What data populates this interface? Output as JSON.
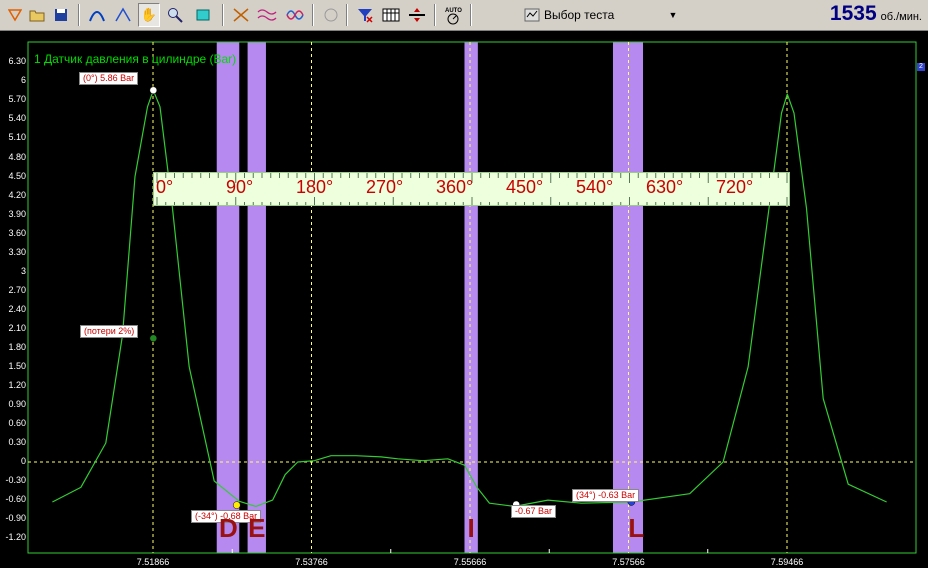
{
  "toolbar": {
    "test_select_label": "Выбор теста",
    "rpm_value": "1535",
    "rpm_unit": "об./мин."
  },
  "plot": {
    "title": "1 Датчик давления в цилиндре (Bar)",
    "y_ticks": [
      "6.30",
      "6",
      "5.70",
      "5.40",
      "5.10",
      "4.80",
      "4.50",
      "4.20",
      "3.90",
      "3.60",
      "3.30",
      "3",
      "2.70",
      "2.40",
      "2.10",
      "1.80",
      "1.50",
      "1.20",
      "0.90",
      "0.60",
      "0.30",
      "0",
      "-0.30",
      "-0.60",
      "-0.90",
      "-1.20"
    ],
    "x_ticks": [
      "7.51866",
      "7.53766",
      "7.55666",
      "7.57566",
      "7.59466"
    ],
    "ruler_ticks": [
      "0°",
      "90°",
      "180°",
      "270°",
      "360°",
      "450°",
      "540°",
      "630°",
      "720°"
    ],
    "markers": [
      "D",
      "E",
      "I",
      "L"
    ],
    "labels": {
      "peak": "(0°) 5.86 Bar",
      "loss": "(потери 2%)",
      "minus34": "(-34°) -0.68 Bar",
      "i_value": "-0.67 Bar",
      "plus34": "(34°) -0.63 Bar"
    },
    "corner": "2"
  },
  "colors": {
    "trace": "#33cc33",
    "title": "#00dd00",
    "highlight": "#b589f0",
    "grid": "#ffff66",
    "label_text": "#cc0000"
  },
  "chart_data": {
    "type": "line",
    "title": "1 Датчик давления в цилиндре (Bar)",
    "xlabel": "",
    "ylabel": "",
    "ylim": [
      -1.35,
      6.5
    ],
    "xlim": [
      7.5066,
      7.6066
    ],
    "x_ticks": [
      7.51866,
      7.53766,
      7.55666,
      7.57566,
      7.59466
    ],
    "series": [
      {
        "x": [
          7.5066,
          7.51,
          7.513,
          7.515,
          7.5165,
          7.518,
          7.5187,
          7.5195,
          7.521,
          7.523,
          7.526,
          7.529,
          7.531,
          7.533,
          7.5345,
          7.536,
          7.538,
          7.54,
          7.543,
          7.546,
          7.548,
          7.551,
          7.554,
          7.556,
          7.5575,
          7.559,
          7.562,
          7.566,
          7.57,
          7.576,
          7.583,
          7.587,
          7.59,
          7.5925,
          7.594,
          7.5947,
          7.5955,
          7.597,
          7.599,
          7.602,
          7.6066
        ],
        "y": [
          -0.63,
          -0.4,
          0.3,
          2.0,
          4.5,
          5.6,
          5.86,
          5.6,
          4.0,
          1.5,
          -0.3,
          -0.62,
          -0.7,
          -0.6,
          -0.2,
          0.0,
          0.02,
          0.1,
          0.1,
          0.08,
          0.05,
          0.02,
          0.05,
          -0.05,
          -0.4,
          -0.65,
          -0.7,
          -0.6,
          -0.65,
          -0.63,
          -0.5,
          0.0,
          1.5,
          4.0,
          5.5,
          5.8,
          5.5,
          4.0,
          1.0,
          -0.35,
          -0.63
        ]
      }
    ],
    "points": [
      {
        "x": 7.5187,
        "y": 5.86,
        "label": "(0°) 5.86 Bar"
      },
      {
        "x": 7.5187,
        "y": 1.95,
        "label": "(потери 2%)"
      },
      {
        "x": 7.5287,
        "y": -0.68,
        "label": "(-34°) -0.68 Bar"
      },
      {
        "x": 7.5622,
        "y": -0.67,
        "label": "-0.67 Bar"
      },
      {
        "x": 7.576,
        "y": -0.63,
        "label": "(34°) -0.63 Bar"
      }
    ],
    "highlight_bands": [
      [
        7.5263,
        7.529
      ],
      [
        7.53,
        7.5322
      ],
      [
        7.556,
        7.5576
      ],
      [
        7.5738,
        7.5774
      ]
    ],
    "grid": true
  }
}
